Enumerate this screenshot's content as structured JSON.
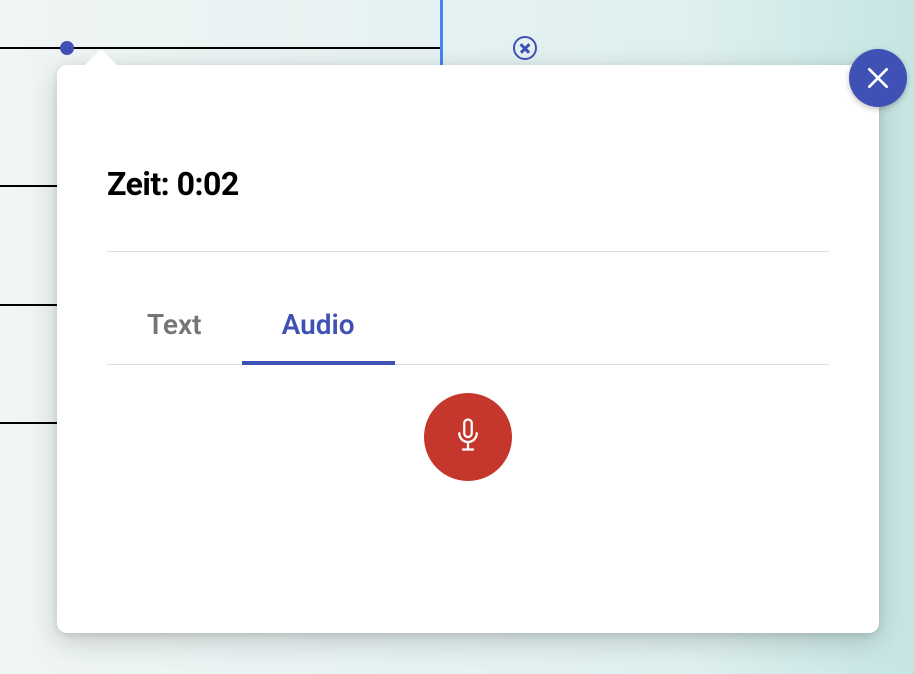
{
  "header": {
    "title_prefix": "Zeit: ",
    "time_value": "0:02"
  },
  "tabs": {
    "text_label": "Text",
    "audio_label": "Audio",
    "active": "audio"
  },
  "icons": {
    "close": "close-icon",
    "mic": "microphone-icon",
    "cancel_circle": "cancel-circle-icon"
  },
  "colors": {
    "primary": "#3f51b5",
    "record": "#c5372c"
  }
}
